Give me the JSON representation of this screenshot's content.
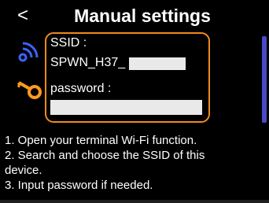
{
  "header": {
    "back_symbol": "<",
    "title": "Manual settings"
  },
  "credentials": {
    "ssid_label": "SSID :",
    "ssid_value": "SPWN_H37_",
    "password_label": "password :"
  },
  "instructions": {
    "line1": "1. Open your terminal Wi-Fi function.",
    "line2": "2. Search and choose the SSID of this",
    "line3": "device.",
    "line4": "3. Input password if needed."
  },
  "icons": {
    "wifi": "wifi-signal-icon",
    "key": "key-icon"
  },
  "colors": {
    "accent": "#f08a1c",
    "icon_blue": "#3a63ff",
    "icon_orange": "#ff9a1f",
    "background": "#000000"
  }
}
